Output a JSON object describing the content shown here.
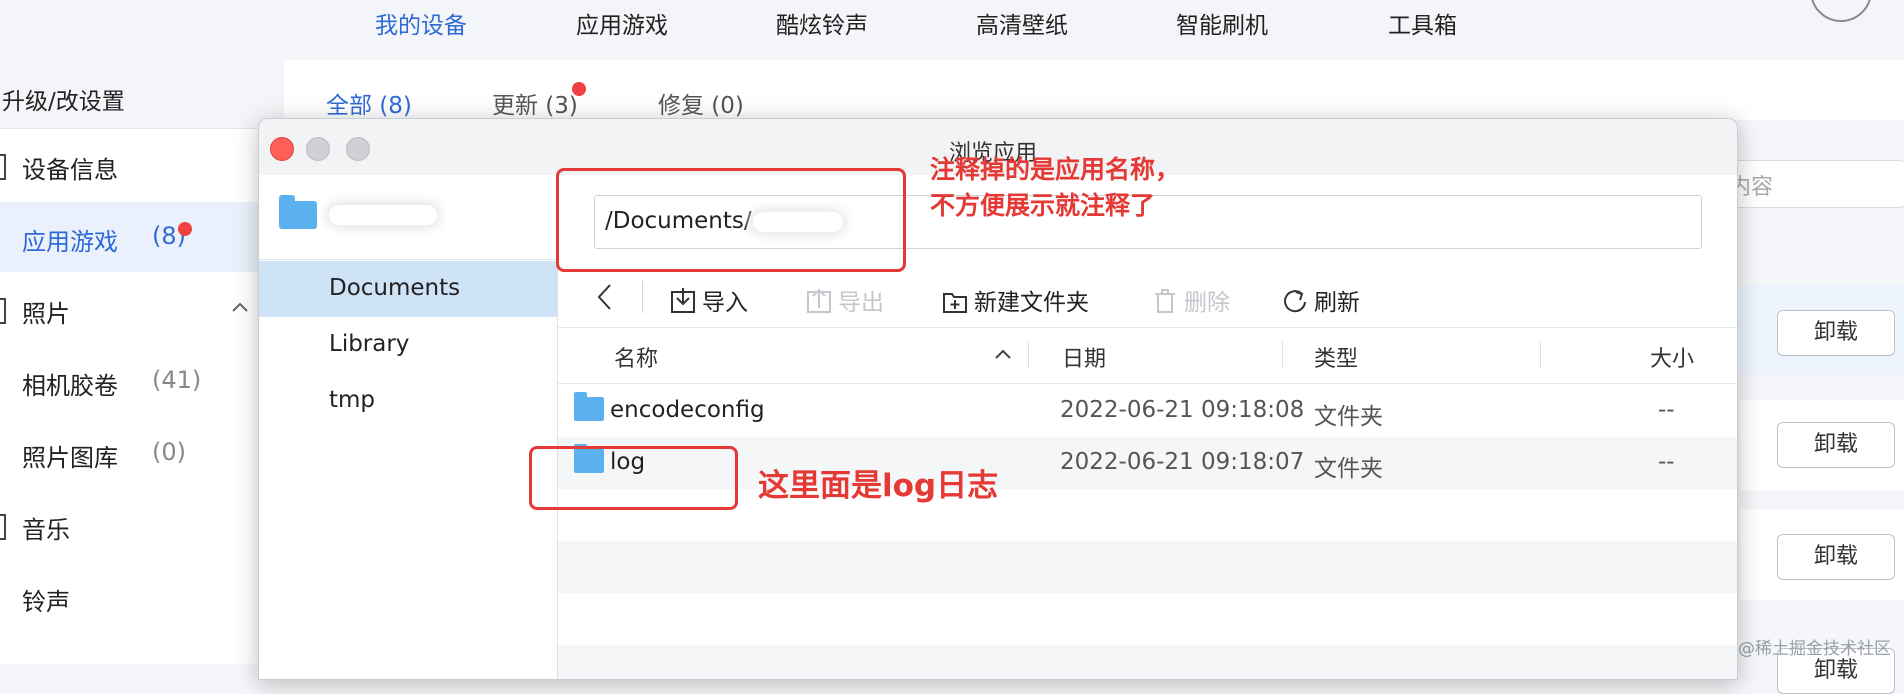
{
  "top_nav": {
    "items": [
      "我的设备",
      "应用游戏",
      "酷炫铃声",
      "高清壁纸",
      "智能刷机",
      "工具箱"
    ],
    "active_index": 0
  },
  "sidebar": {
    "header": "升级/改设置",
    "items": [
      {
        "label": "设备信息",
        "count": ""
      },
      {
        "label": "应用游戏",
        "count": "(8)"
      },
      {
        "label": "照片",
        "count": ""
      },
      {
        "label": "相机胶卷",
        "count": "(41)"
      },
      {
        "label": "照片图库",
        "count": "(0)"
      },
      {
        "label": "音乐",
        "count": ""
      },
      {
        "label": "铃声",
        "count": ""
      }
    ]
  },
  "main_tabs": [
    "全部 (8)",
    "更新 (3)",
    "修复 (0)"
  ],
  "search_placeholder_fragment": "内容",
  "unload_label": "卸载",
  "watermark": "@稀土掘金技术社区",
  "dialog": {
    "title": "浏览应用",
    "side_items": [
      "Documents",
      "Library",
      "tmp"
    ],
    "selected_side": "Documents",
    "path": "/Documents/",
    "toolbar": {
      "import": "导入",
      "export": "导出",
      "new_folder": "新建文件夹",
      "delete": "删除",
      "refresh": "刷新"
    },
    "columns": {
      "name": "名称",
      "date": "日期",
      "type": "类型",
      "size": "大小"
    },
    "files": [
      {
        "name": "encodeconfig",
        "date": "2022-06-21 09:18:08",
        "type": "文件夹",
        "size": "--"
      },
      {
        "name": "log",
        "date": "2022-06-21 09:18:07",
        "type": "文件夹",
        "size": "--"
      }
    ]
  },
  "annotations": {
    "path_note_line1": "注释掉的是应用名称，",
    "path_note_line2": "不方便展示就注释了",
    "log_note": "这里面是log日志",
    "color": "#e53935"
  },
  "colors": {
    "accent": "#2f6bd6",
    "folder": "#5bb0ee",
    "selected_row": "#cfe3f7"
  }
}
